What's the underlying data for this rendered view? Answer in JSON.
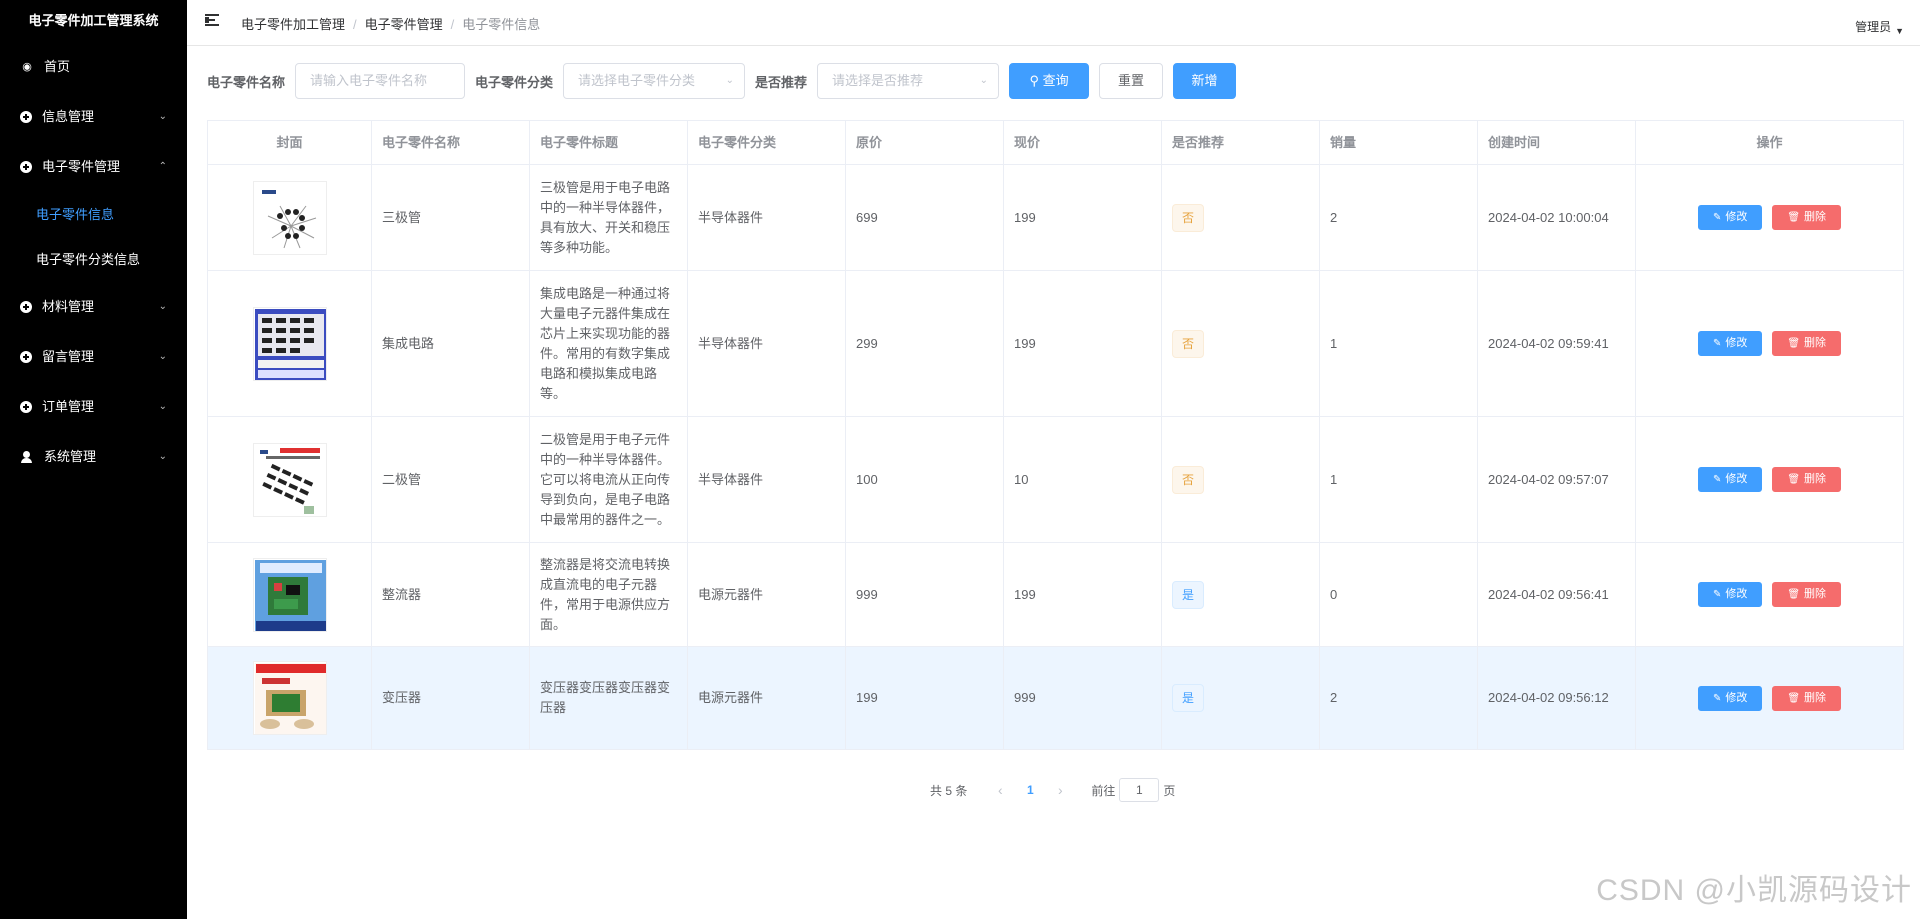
{
  "app_title": "电子零件加工管理系统",
  "sidebar": {
    "items": [
      {
        "label": "首页",
        "icon": "dashboard-icon",
        "expandable": false
      },
      {
        "label": "信息管理",
        "icon": "plus-circle-icon",
        "expandable": true,
        "expanded": false
      },
      {
        "label": "电子零件管理",
        "icon": "plus-circle-icon",
        "expandable": true,
        "expanded": true,
        "children": [
          {
            "label": "电子零件信息",
            "active": true
          },
          {
            "label": "电子零件分类信息",
            "active": false
          }
        ]
      },
      {
        "label": "材料管理",
        "icon": "plus-circle-icon",
        "expandable": true,
        "expanded": false
      },
      {
        "label": "留言管理",
        "icon": "plus-circle-icon",
        "expandable": true,
        "expanded": false
      },
      {
        "label": "订单管理",
        "icon": "plus-circle-icon",
        "expandable": true,
        "expanded": false
      },
      {
        "label": "系统管理",
        "icon": "user-icon",
        "expandable": true,
        "expanded": false
      }
    ]
  },
  "header": {
    "breadcrumb": [
      "电子零件加工管理",
      "电子零件管理",
      "电子零件信息"
    ],
    "user": "管理员"
  },
  "search": {
    "name_label": "电子零件名称",
    "name_placeholder": "请输入电子零件名称",
    "category_label": "电子零件分类",
    "category_placeholder": "请选择电子零件分类",
    "recommend_label": "是否推荐",
    "recommend_placeholder": "请选择是否推荐",
    "query_button": "查询",
    "reset_button": "重置",
    "add_button": "新增"
  },
  "table": {
    "headers": [
      "封面",
      "电子零件名称",
      "电子零件标题",
      "电子零件分类",
      "原价",
      "现价",
      "是否推荐",
      "销量",
      "创建时间",
      "操作"
    ],
    "edit_label": "修改",
    "delete_label": "删除",
    "rows": [
      {
        "name": "三极管",
        "title": "三极管是用于电子电路中的一种半导体器件，具有放大、开关和稳压等多种功能。",
        "category": "半导体器件",
        "original_price": "699",
        "current_price": "199",
        "recommend": "否",
        "sales": "2",
        "created": "2024-04-02 10:00:04"
      },
      {
        "name": "集成电路",
        "title": "集成电路是一种通过将大量电子元器件集成在芯片上来实现功能的器件。常用的有数字集成电路和模拟集成电路等。",
        "category": "半导体器件",
        "original_price": "299",
        "current_price": "199",
        "recommend": "否",
        "sales": "1",
        "created": "2024-04-02 09:59:41"
      },
      {
        "name": "二极管",
        "title": "二极管是用于电子元件中的一种半导体器件。它可以将电流从正向传导到负向，是电子电路中最常用的器件之一。",
        "category": "半导体器件",
        "original_price": "100",
        "current_price": "10",
        "recommend": "否",
        "sales": "1",
        "created": "2024-04-02 09:57:07"
      },
      {
        "name": "整流器",
        "title": "整流器是将交流电转换成直流电的电子元器件，常用于电源供应方面。",
        "category": "电源元器件",
        "original_price": "999",
        "current_price": "199",
        "recommend": "是",
        "sales": "0",
        "created": "2024-04-02 09:56:41"
      },
      {
        "name": "变压器",
        "title": "变压器变压器变压器变压器",
        "category": "电源元器件",
        "original_price": "199",
        "current_price": "999",
        "recommend": "是",
        "sales": "2",
        "created": "2024-04-02 09:56:12"
      }
    ]
  },
  "pagination": {
    "total_text": "共 5 条",
    "current_page": "1",
    "goto_prefix": "前往",
    "goto_value": "1",
    "goto_suffix": "页"
  },
  "watermark": "CSDN @小凯源码设计",
  "colors": {
    "primary": "#409eff",
    "danger": "#f56c6c",
    "warning": "#e6a23c",
    "sidebar_bg": "#000000"
  }
}
